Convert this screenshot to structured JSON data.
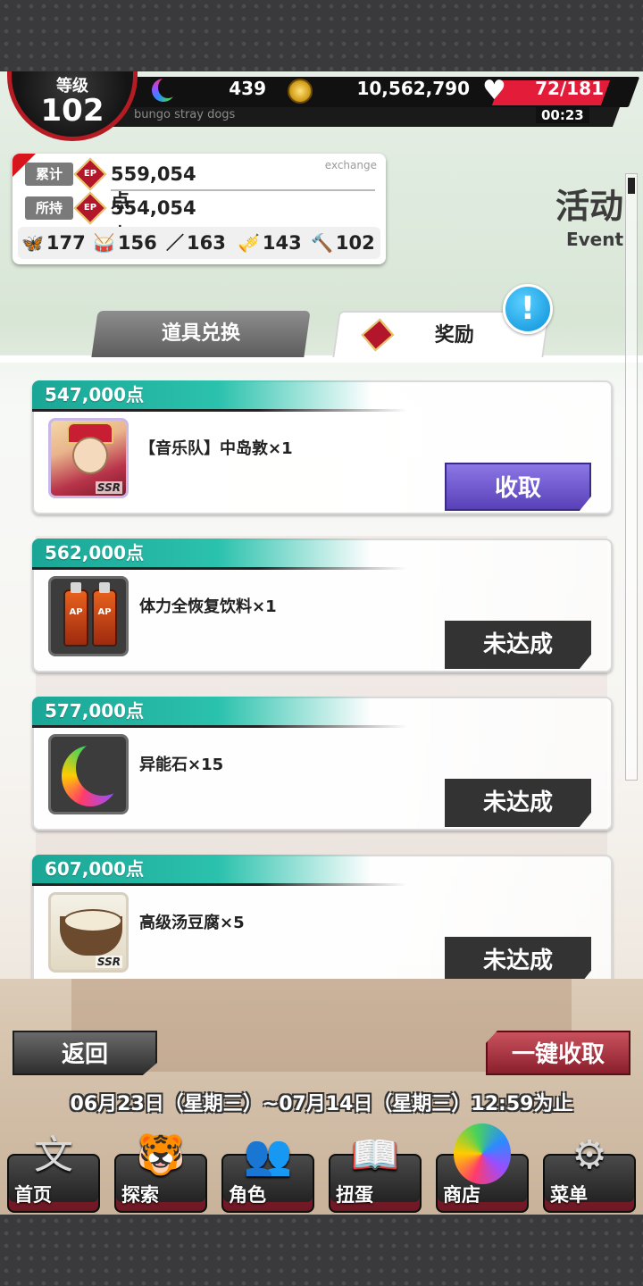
{
  "header": {
    "level_label": "等级",
    "level_value": "102",
    "stones": "439",
    "coins": "10,562,790",
    "ap_icon": "heart-ap-icon",
    "ap": "72/181",
    "ap_timer": "00:23",
    "brand": "bungo stray dogs"
  },
  "points": {
    "exchange_label": "exchange",
    "total_label": "累计",
    "total_value": "559,054点",
    "held_label": "所持",
    "held_value": "554,054点",
    "ep_label": "EP",
    "items": [
      {
        "icon": "butterfly-icon",
        "glyph": "🦋",
        "value": "177"
      },
      {
        "icon": "drum-icon",
        "glyph": "🥁",
        "value": "156"
      },
      {
        "icon": "baton-icon",
        "glyph": "／",
        "value": "163"
      },
      {
        "icon": "trumpet-icon",
        "glyph": "🎺",
        "value": "143"
      },
      {
        "icon": "cymbal-stick-icon",
        "glyph": "🔨",
        "value": "102"
      }
    ]
  },
  "section": {
    "title": "活动",
    "subtitle": "Event"
  },
  "tabs": {
    "exchange": "道具兑换",
    "rewards": "奖励",
    "rewards_ep": "EP",
    "alert": "!"
  },
  "rewards": [
    {
      "points": "547,000点",
      "name": "【音乐队】中岛敦×1",
      "button": "收取",
      "thumb": "card",
      "rarity": "SSR"
    },
    {
      "points": "562,000点",
      "name": "体力全恢复饮料×1",
      "button": "未达成",
      "thumb": "drink"
    },
    {
      "points": "577,000点",
      "name": "异能石×15",
      "button": "未达成",
      "thumb": "stone"
    },
    {
      "points": "607,000点",
      "name": "高级汤豆腐×5",
      "button": "未达成",
      "thumb": "tofu",
      "rarity": "SSR"
    }
  ],
  "footer": {
    "back": "返回",
    "collect_all": "一键收取",
    "period": "06月23日（星期三）~07月14日（星期三）12:59为止"
  },
  "nav": [
    {
      "label": "首页",
      "icon": "home-bungo-icon",
      "glyph": "文"
    },
    {
      "label": "探索",
      "icon": "tiger-icon",
      "glyph": "🐯"
    },
    {
      "label": "角色",
      "icon": "characters-icon",
      "glyph": "👥"
    },
    {
      "label": "扭蛋",
      "icon": "book-icon",
      "glyph": "📖"
    },
    {
      "label": "商店",
      "icon": "stone-shop-icon",
      "glyph": ""
    },
    {
      "label": "菜单",
      "icon": "gear-icon",
      "glyph": "⚙"
    }
  ],
  "colors": {
    "accent_red": "#d8141c",
    "teal": "#1aa696",
    "collect_purple": "#5940b8"
  }
}
